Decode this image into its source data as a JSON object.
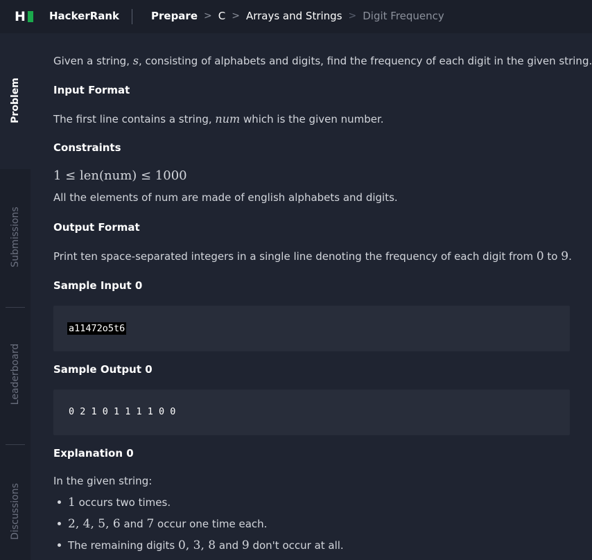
{
  "topbar": {
    "logo_letter": "H",
    "brand": "HackerRank",
    "breadcrumbs": [
      "Prepare",
      "C",
      "Arrays and Strings",
      "Digit Frequency"
    ],
    "separator": ">"
  },
  "sidebar": {
    "tabs": [
      "Problem",
      "Submissions",
      "Leaderboard",
      "Discussions"
    ]
  },
  "problem": {
    "intro_prefix": "Given a string, ",
    "intro_var": "s",
    "intro_suffix": ", consisting of alphabets and digits, find the frequency of each digit in the given string.",
    "input_format_heading": "Input Format",
    "input_format_prefix": "The first line contains a string, ",
    "input_format_var": "num",
    "input_format_suffix": " which is the given number.",
    "constraints_heading": "Constraints",
    "constraint_formula": "1 ≤ len(num) ≤ 1000",
    "constraint_text": "All the elements of num are made of english alphabets and digits.",
    "output_format_heading": "Output Format",
    "output_format_prefix": "Print ten space-separated integers in a single line denoting the frequency of each digit from ",
    "output_from": "0",
    "output_to_word": " to ",
    "output_to": "9",
    "output_end": ".",
    "sample_input_heading": "Sample Input 0",
    "sample_input": "a11472o5t6",
    "sample_output_heading": "Sample Output 0",
    "sample_output": "0 2 1 0 1 1 1 1 0 0",
    "explanation_heading": "Explanation 0",
    "explanation_intro": "In the given string:",
    "bullets": [
      {
        "math": "1",
        "text": " occurs two times."
      },
      {
        "math": "2, 4, 5, 6",
        "text": " and ",
        "math2": "7",
        "text2": " occur one time each."
      },
      {
        "text": "The remaining digits ",
        "math": "0, 3, 8",
        "text2": " and ",
        "math2": "9",
        "text3": " don't occur at all."
      }
    ]
  },
  "colors": {
    "background": "#1f2431",
    "topbar": "#1b1f2a",
    "code_box": "#282d3a",
    "logo_green": "#1ba94c"
  }
}
